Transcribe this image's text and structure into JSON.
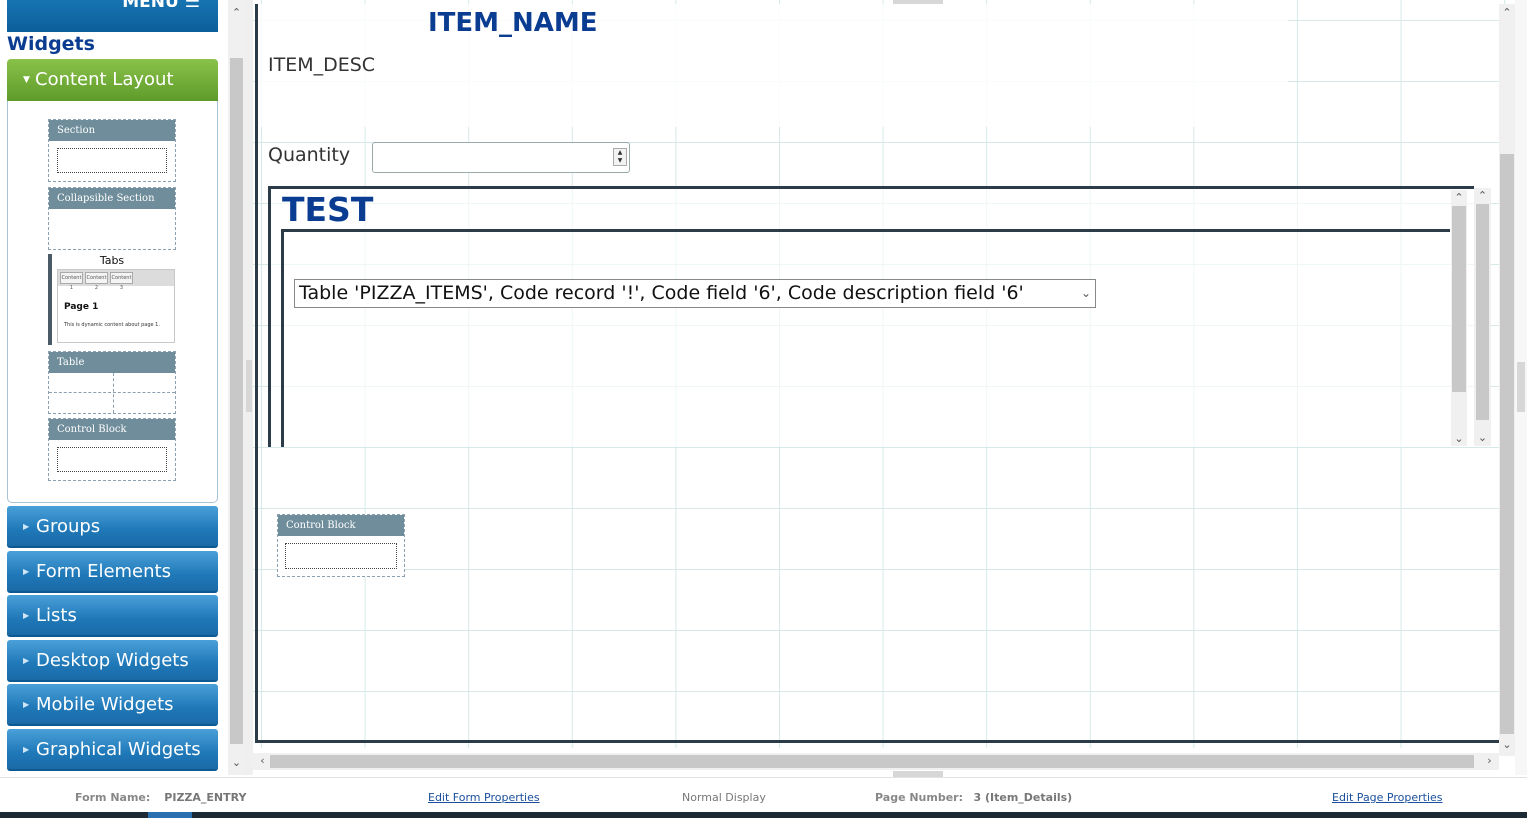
{
  "sidebar": {
    "menu_label": "MENU ☰",
    "title": "Widgets",
    "content_layout": {
      "label": "Content Layout",
      "tiles": {
        "section": "Section",
        "collapsible_section": "Collapsible Section",
        "tabs": "Tabs",
        "tabs_preview": {
          "tab1": "Content 1",
          "tab2": "Content 2",
          "tab3": "Content 3",
          "page_title": "Page 1",
          "page_text": "This is dynamic content about page 1."
        },
        "table": "Table",
        "control_block": "Control Block"
      }
    },
    "accordion": [
      "Groups",
      "Form Elements",
      "Lists",
      "Desktop Widgets",
      "Mobile Widgets",
      "Graphical Widgets"
    ]
  },
  "canvas": {
    "item_name": "ITEM_NAME",
    "item_desc": "ITEM_DESC",
    "quantity_label": "Quantity",
    "quantity_value": "",
    "section_title": "TEST",
    "table_select_value": "Table 'PIZZA_ITEMS', Code record '!', Code field '6', Code description field '6'",
    "control_block_label": "Control Block"
  },
  "status_bar": {
    "form_name_label": "Form Name:",
    "form_name_value": "PIZZA_ENTRY",
    "edit_form_link": "Edit Form Properties",
    "display_mode": "Normal Display",
    "page_number_label": "Page Number:",
    "page_number_value": "3 (Item_Details)",
    "edit_page_link": "Edit Page Properties"
  },
  "colors": {
    "title_blue": "#0a3d91",
    "accordion_blue": "#1f78b8",
    "content_layout_green": "#6eaa34",
    "tile_header": "#6f8d9b"
  }
}
